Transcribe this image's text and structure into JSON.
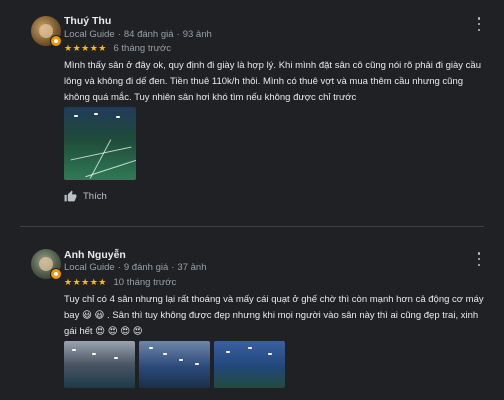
{
  "reviews": [
    {
      "author": "Thuý Thu",
      "badge": "Local Guide",
      "review_count": "84 đánh giá",
      "photo_count": "93 ảnh",
      "stars": "★★★★★",
      "rating": 5,
      "time": "6 tháng trước",
      "text": "Mình thấy sân ở đây ok, quy định đi giày là hợp lý. Khi mình đặt sân cô cũng nói rõ phải đi giày cầu lông và không đi dế đen. Tiền thuê 110k/h thôi. Mình có thuê vợt và mua thêm cầu nhưng cũng không quá mắc. Tuy nhiên sân hơi khó tìm nếu không được chỉ trước",
      "like_label": "Thích"
    },
    {
      "author": "Anh Nguyễn",
      "badge": "Local Guide",
      "review_count": "9 đánh giá",
      "photo_count": "37 ảnh",
      "stars": "★★★★★",
      "rating": 5,
      "time": "10 tháng trước",
      "text": "Tuy chỉ có 4 sân nhưng lại rất thoáng và mấy cái quạt ở ghế chờ thì còn mạnh hơn cả động cơ máy bay 😃 😃 . Sân thì tuy không được đẹp nhưng khi mọi người vào sân này thì ai cũng đẹp trai, xinh gái hết 😍 😍 😍 😍"
    }
  ],
  "colors": {
    "background": "#202124",
    "star": "#fbbc04",
    "badge": "#f29900",
    "muted_text": "#9aa0a6"
  },
  "icons": {
    "more": "more-vert-icon",
    "like": "thumb-up-icon",
    "badge": "local-guide-badge-icon"
  }
}
